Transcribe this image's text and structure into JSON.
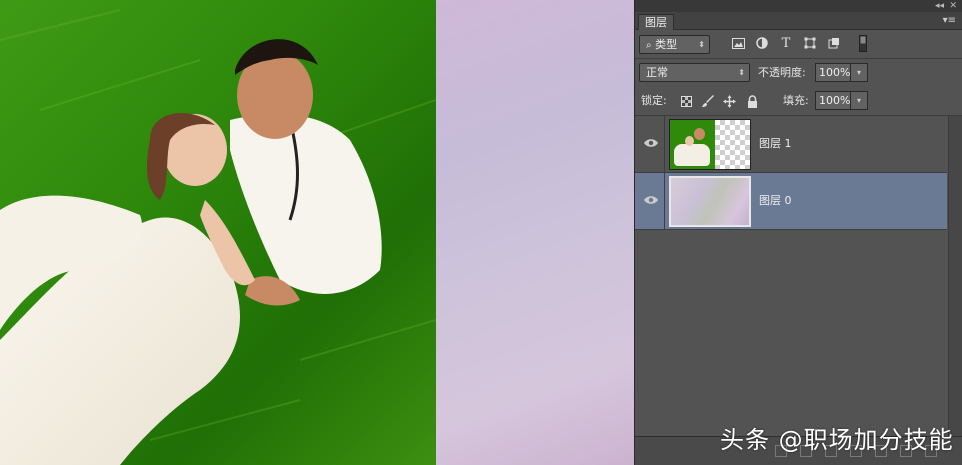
{
  "panel": {
    "tab_label": "图层",
    "filter_label": "类型",
    "blend_mode": "正常",
    "opacity_label": "不透明度:",
    "opacity_value": "100%",
    "lock_label": "锁定:",
    "fill_label": "填充:",
    "fill_value": "100%"
  },
  "layers": [
    {
      "name": "图层 1",
      "selected": false
    },
    {
      "name": "图层 0",
      "selected": true
    }
  ],
  "watermark": "头条 @职场加分技能",
  "colors": {
    "panel_bg": "#535353",
    "selected_layer": "#6a7a94",
    "grass": "#2f8a0c",
    "gradient_lilac": "#cdc3da"
  },
  "icons": [
    "search-icon",
    "image-filter-icon",
    "adjust-filter-icon",
    "type-filter-icon",
    "shape-filter-icon",
    "smart-filter-icon",
    "eye-icon",
    "lock-icon",
    "brush-icon",
    "move-icon"
  ]
}
